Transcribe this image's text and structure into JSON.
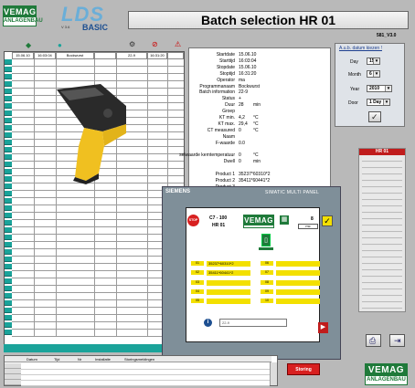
{
  "header": {
    "logo": {
      "word": "VEMAG",
      "sub": "ANLAGENBAU"
    },
    "lds": {
      "big": "LDS",
      "version": "V 3.6",
      "basic": "BASIC"
    },
    "title": "Batch selection HR 01",
    "build": "581_V3.0"
  },
  "grid": {
    "first_row": [
      "15.06.10",
      "16:03:04",
      "Bockwurst",
      "",
      "22-9",
      "",
      "16:31:20",
      ""
    ],
    "status_count": "53"
  },
  "details": [
    {
      "label": "Startdate",
      "value": "15.06.10",
      "unit": ""
    },
    {
      "label": "Starttijd",
      "value": "16:03:04",
      "unit": ""
    },
    {
      "label": "Stopdate",
      "value": "15.06.10",
      "unit": ""
    },
    {
      "label": "Stoptijd",
      "value": "16:31:20",
      "unit": ""
    },
    {
      "label": "Operator",
      "value": "ma",
      "unit": ""
    },
    {
      "label": "Programmanaam",
      "value": "Bockwurst",
      "unit": ""
    },
    {
      "label": "Batch information",
      "value": "22-9",
      "unit": ""
    },
    {
      "label": "Status",
      "value": "+",
      "unit": ""
    },
    {
      "label": "Duur",
      "value": "28",
      "unit": "min"
    },
    {
      "label": "Groep",
      "value": "",
      "unit": ""
    },
    {
      "label": "KT min.",
      "value": "4,2",
      "unit": "°C"
    },
    {
      "label": "KT max.",
      "value": "29,4",
      "unit": "°C"
    },
    {
      "label": "CT measured",
      "value": "0",
      "unit": "°C"
    },
    {
      "label": "Naam",
      "value": "",
      "unit": ""
    },
    {
      "label": "F-waarde",
      "value": "0.0",
      "unit": ""
    },
    {
      "label": "",
      "value": "",
      "unit": ""
    },
    {
      "label": "selwaarde kerntemperatuur",
      "value": "0",
      "unit": "°C"
    },
    {
      "label": "Dwell",
      "value": "0",
      "unit": "min"
    },
    {
      "label": "",
      "value": "",
      "unit": ""
    },
    {
      "label": "Product 1",
      "value": "35237*60310*2",
      "unit": ""
    },
    {
      "label": "Product 2",
      "value": "35411*60441*2",
      "unit": ""
    },
    {
      "label": "Product 3",
      "value": "",
      "unit": ""
    }
  ],
  "date_panel": {
    "title": "A.u.b. datum kiezen !",
    "day_label": "Day",
    "day": "15",
    "month_label": "Month",
    "month": "6",
    "year_label": "Year",
    "year": "2010",
    "door_label": "Door",
    "door": "1 Day"
  },
  "right_list": {
    "title": "HR 01"
  },
  "hmi": {
    "brand": "SIEMENS",
    "model": "SIMATIC MULTI PANEL",
    "stop": "STOP",
    "machine": "C7 - 100",
    "unit": "HR 01",
    "logo": "VEMAG",
    "counter": "8",
    "small_field": "mc",
    "left_labels": [
      "01",
      "02",
      "03",
      "04",
      "05"
    ],
    "left_values": [
      "35237*60310*2",
      "35411*60441*2",
      "",
      "",
      ""
    ],
    "right_labels": [
      "06",
      "07",
      "08",
      "09",
      "10"
    ],
    "info_text": "22-9"
  },
  "bottom": {
    "columns": [
      "Datum",
      "Tijd",
      "Nr",
      "Installatie",
      "Storingsmeldingen"
    ],
    "alarm_button": "Storing",
    "logo": {
      "word": "VEMAG",
      "sub": "ANLAGENBAU"
    }
  },
  "colors": {
    "accent": "#1aa39a",
    "brand": "#1f7a3a",
    "alarm": "#d82020",
    "hmi_yellow": "#f3e000"
  }
}
